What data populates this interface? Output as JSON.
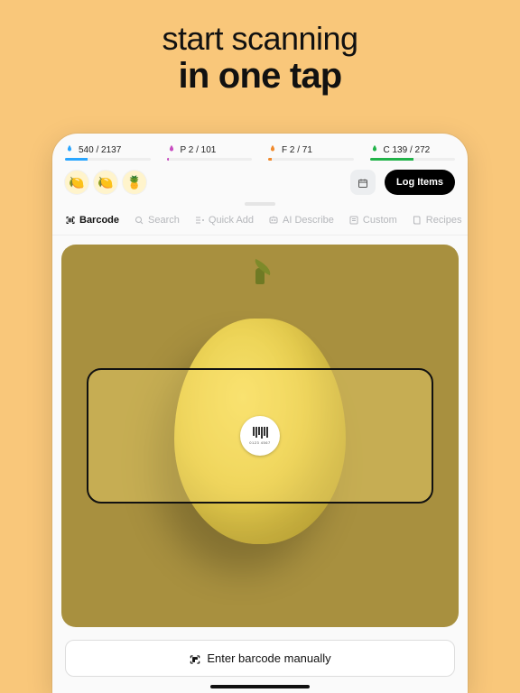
{
  "hero": {
    "line1": "start scanning",
    "line2": "in one tap"
  },
  "macros": [
    {
      "icon_color": "#2aa6ff",
      "text": "540 / 2137",
      "fill_pct": 26,
      "fill_color": "#2aa6ff"
    },
    {
      "icon_color": "#c74cc0",
      "text": "P 2 / 101",
      "fill_pct": 3,
      "fill_color": "#c74cc0"
    },
    {
      "icon_color": "#f08a2d",
      "text": "F 2 / 71",
      "fill_pct": 4,
      "fill_color": "#f08a2d"
    },
    {
      "icon_color": "#22b34a",
      "text": "C 139 / 272",
      "fill_pct": 51,
      "fill_color": "#22b34a"
    }
  ],
  "recent_items": [
    {
      "emoji": "🍋"
    },
    {
      "emoji": "🍋"
    },
    {
      "emoji": "🍍"
    }
  ],
  "header": {
    "log_button": "Log Items"
  },
  "tabs": [
    {
      "id": "barcode",
      "label": "Barcode",
      "active": true
    },
    {
      "id": "search",
      "label": "Search",
      "active": false
    },
    {
      "id": "quickadd",
      "label": "Quick Add",
      "active": false
    },
    {
      "id": "aidescribe",
      "label": "AI Describe",
      "active": false
    },
    {
      "id": "custom",
      "label": "Custom",
      "active": false
    },
    {
      "id": "recipes",
      "label": "Recipes",
      "active": false
    }
  ],
  "manual_button": "Enter barcode manually",
  "sticker_code": "0123 4567"
}
